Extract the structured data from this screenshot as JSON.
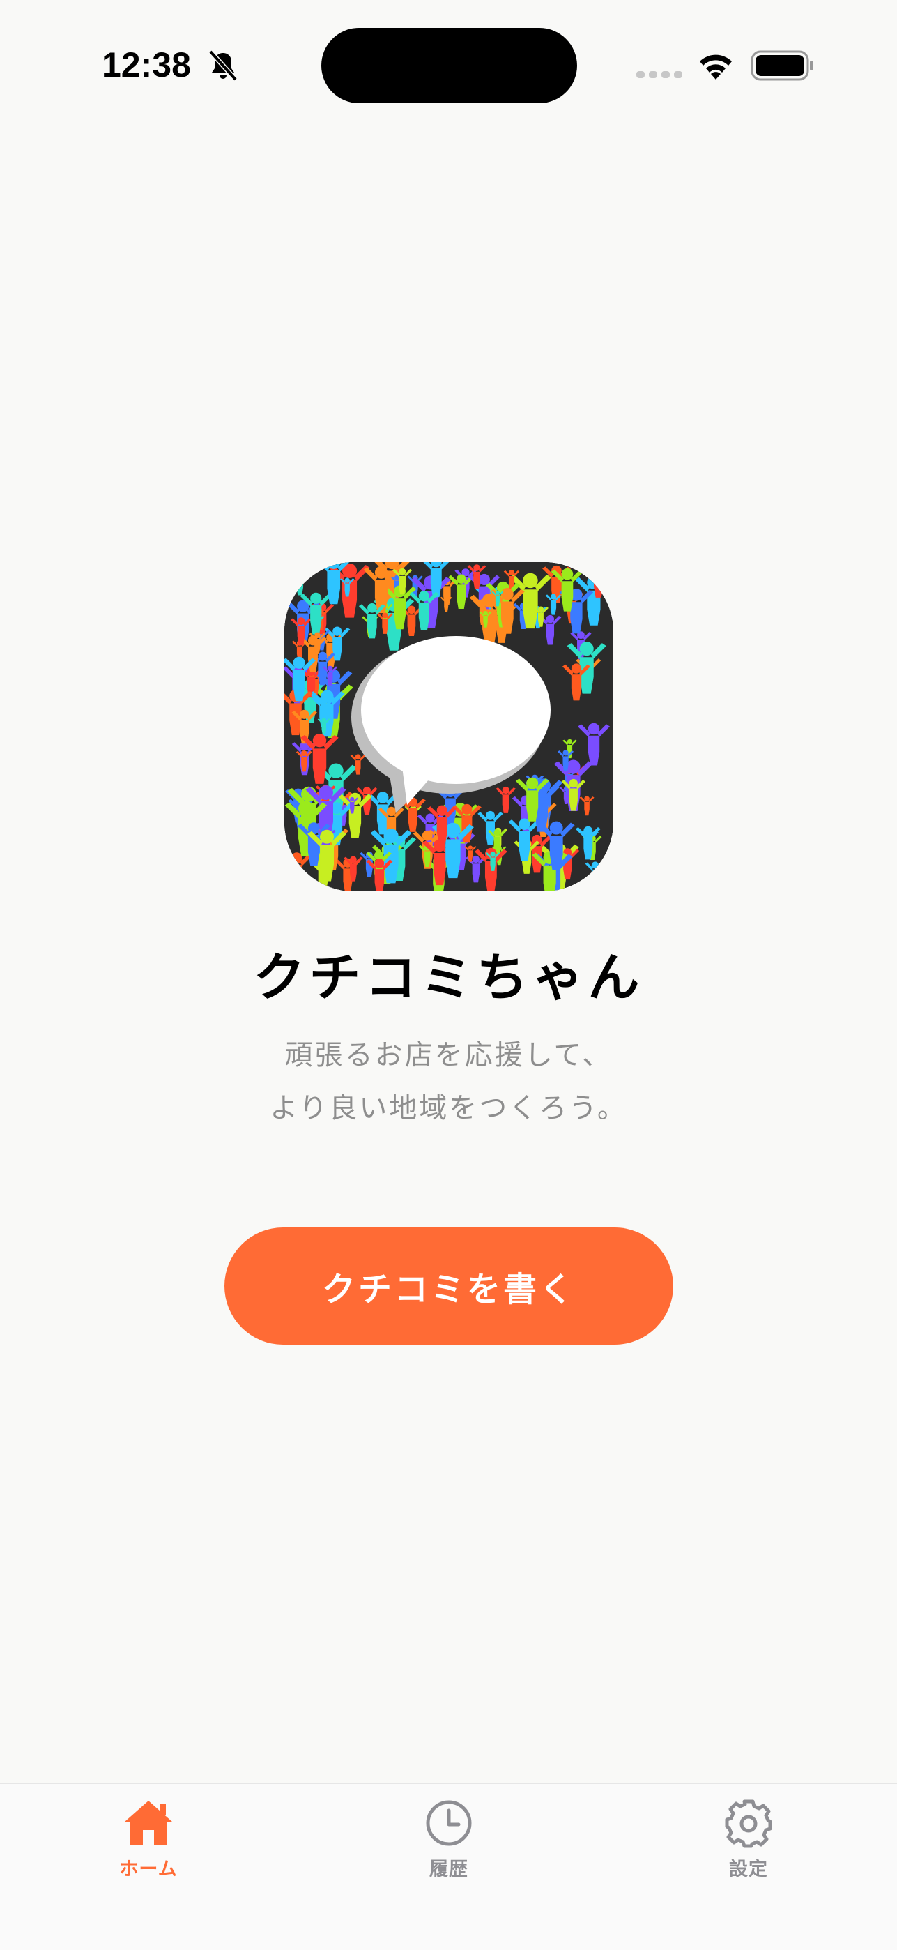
{
  "status_bar": {
    "time": "12:38"
  },
  "app": {
    "name": "クチコミちゃん",
    "tagline_line1": "頑張るお店を応援して、",
    "tagline_line2": "より良い地域をつくろう。",
    "icon": "people-speech-bubble-icon"
  },
  "actions": {
    "write_review_label": "クチコミを書く"
  },
  "tab_bar": {
    "active_tab": "home",
    "tabs": [
      {
        "id": "home",
        "label": "ホーム",
        "icon": "house-icon"
      },
      {
        "id": "history",
        "label": "履歴",
        "icon": "clock-icon"
      },
      {
        "id": "settings",
        "label": "設定",
        "icon": "gear-icon"
      }
    ]
  },
  "colors": {
    "accent": "#ff6b35",
    "background": "#f9f9f7",
    "inactive": "#8e8e93",
    "subtext": "#8e8e8e"
  }
}
